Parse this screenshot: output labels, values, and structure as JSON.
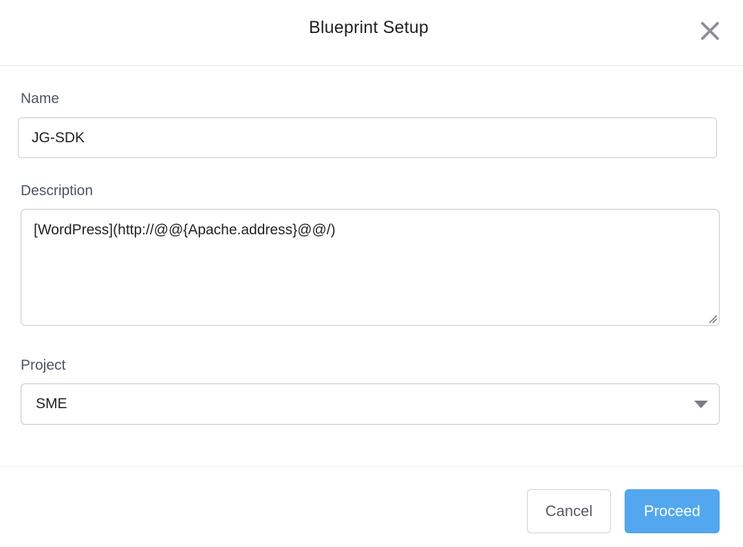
{
  "dialog": {
    "title": "Blueprint Setup",
    "close_icon": "close-icon"
  },
  "form": {
    "name_label": "Name",
    "name_value": "JG-SDK",
    "description_label": "Description",
    "description_value": "[WordPress](http://@@{Apache.address}@@/)",
    "project_label": "Project",
    "project_selected": "SME",
    "project_caret_icon": "caret-down-icon"
  },
  "footer": {
    "cancel_label": "Cancel",
    "proceed_label": "Proceed"
  },
  "colors": {
    "primary": "#52a7ef",
    "border": "#c4c7cc",
    "label": "#4a5563"
  }
}
